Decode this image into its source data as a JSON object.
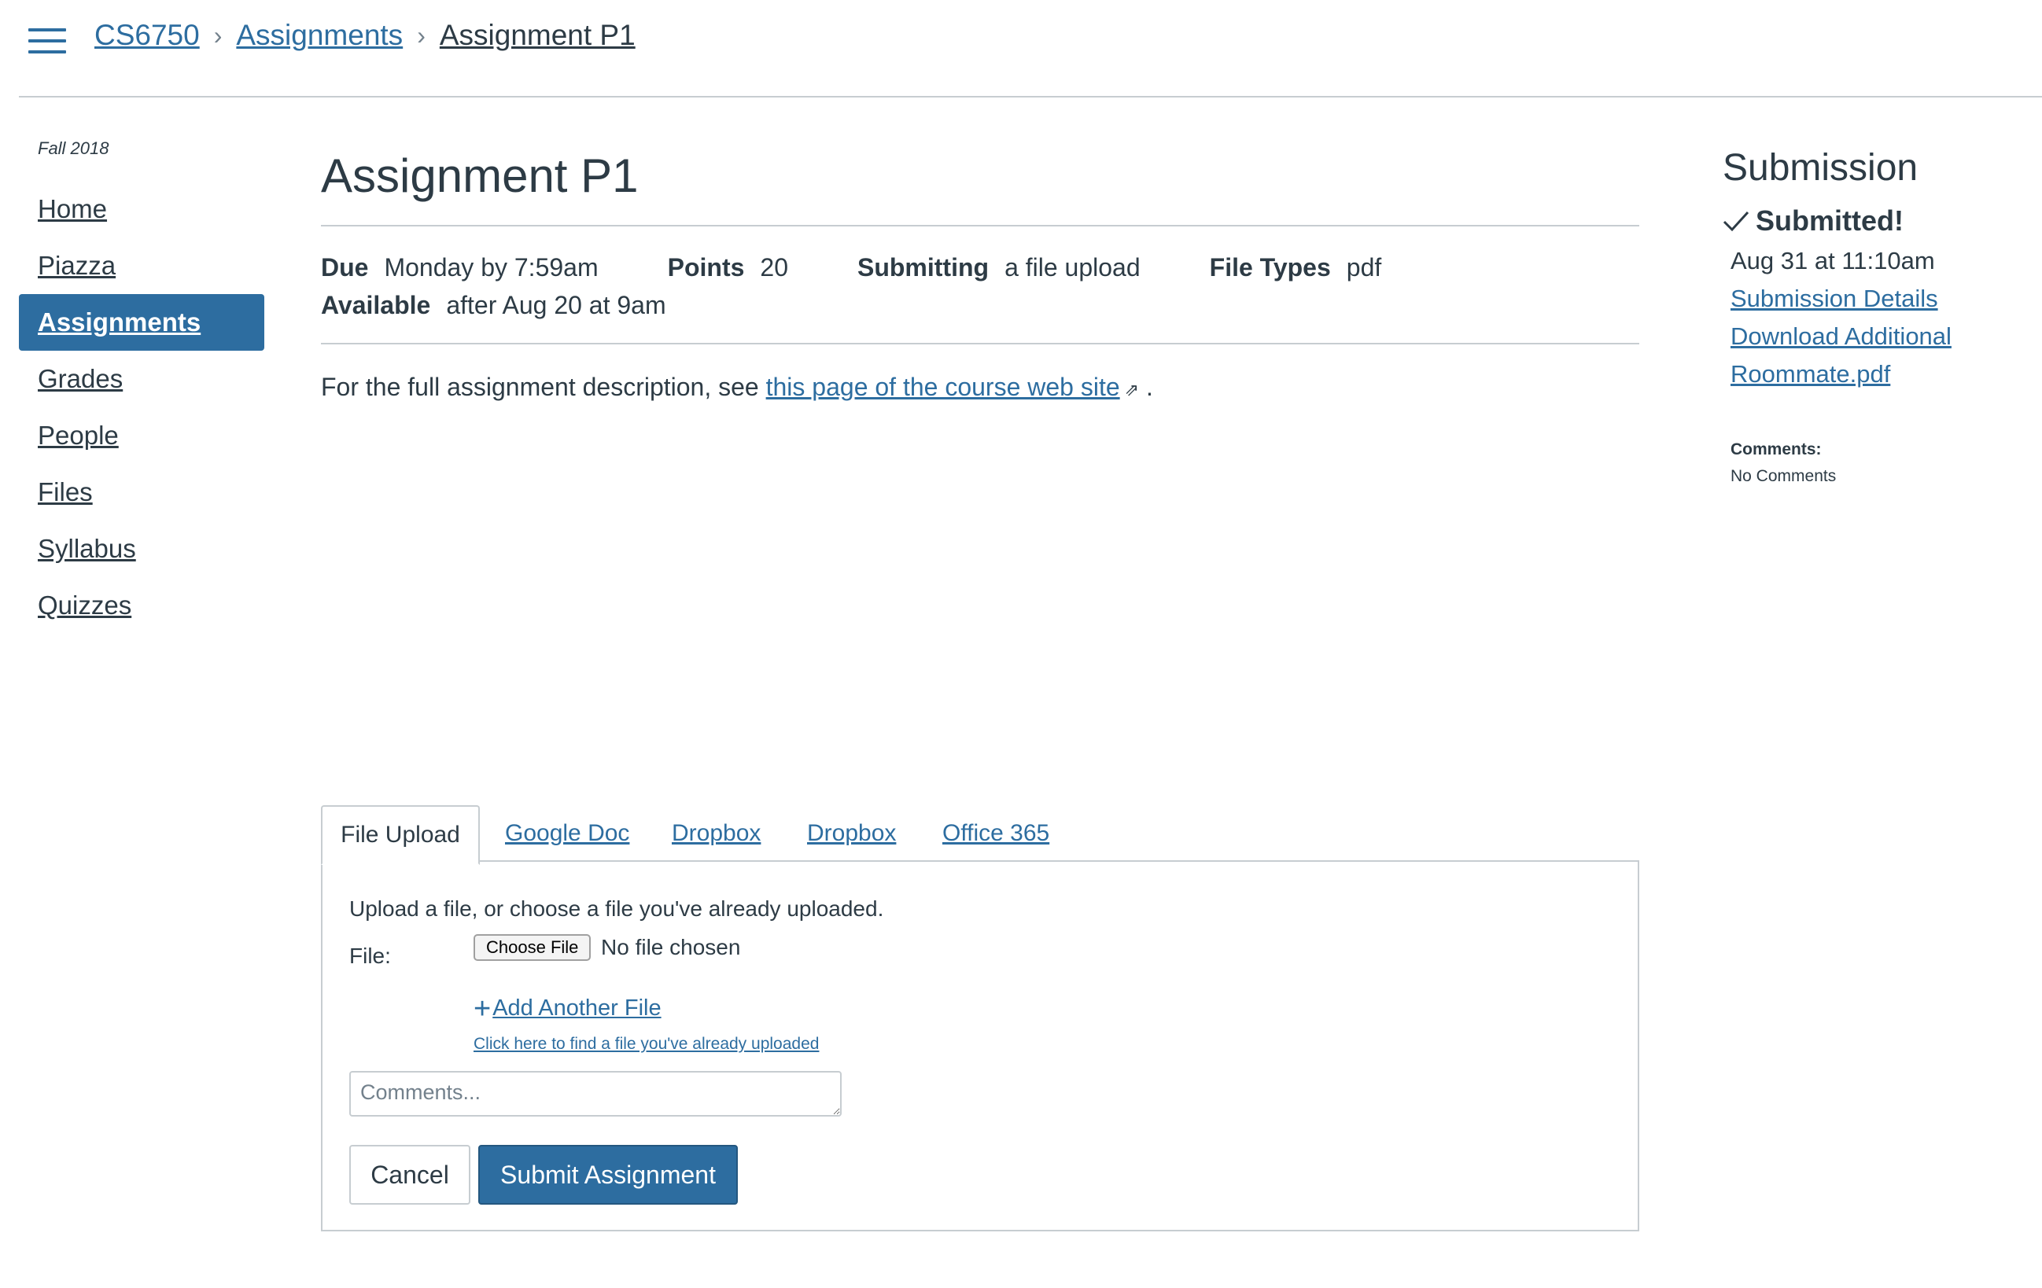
{
  "breadcrumb": {
    "course": "CS6750",
    "section": "Assignments",
    "current": "Assignment P1",
    "separator": "›"
  },
  "nav": {
    "term": "Fall 2018",
    "items": [
      "Home",
      "Piazza",
      "Assignments",
      "Grades",
      "People",
      "Files",
      "Syllabus",
      "Quizzes"
    ],
    "active": "Assignments"
  },
  "assignment": {
    "title": "Assignment P1",
    "due_label": "Due",
    "due_value": "Monday by 7:59am",
    "points_label": "Points",
    "points_value": "20",
    "submitting_label": "Submitting",
    "submitting_value": "a file upload",
    "file_types_label": "File Types",
    "file_types_value": "pdf",
    "available_label": "Available",
    "available_value": "after Aug 20 at 9am",
    "description_prefix": "For the full assignment description, see ",
    "description_link": "this page of the course web site",
    "description_suffix": "."
  },
  "tabs": [
    "File Upload",
    "Google Doc",
    "Dropbox",
    "Dropbox",
    "Office 365"
  ],
  "upload": {
    "instructions": "Upload a file, or choose a file you've already uploaded.",
    "file_label": "File:",
    "choose_file": "Choose File",
    "no_file": "No file chosen",
    "add_another": "Add Another File",
    "find_uploaded": "Click here to find a file you've already uploaded",
    "comments_placeholder": "Comments...",
    "cancel": "Cancel",
    "submit": "Submit Assignment"
  },
  "submission": {
    "title": "Submission",
    "status": "Submitted!",
    "date": "Aug 31 at 11:10am",
    "details_link": "Submission Details",
    "download_line1": "Download Additional",
    "download_line2": "Roommate.pdf",
    "comments_label": "Comments:",
    "comments_value": "No Comments"
  },
  "colors": {
    "link": "#2d6da0",
    "active_nav_bg": "#2d6da0",
    "text": "#2d3b45",
    "border": "#c7cdd1"
  },
  "icons": [
    "hamburger-menu-icon",
    "chevron-right-icon",
    "external-link-icon",
    "plus-icon",
    "checkmark-icon"
  ]
}
